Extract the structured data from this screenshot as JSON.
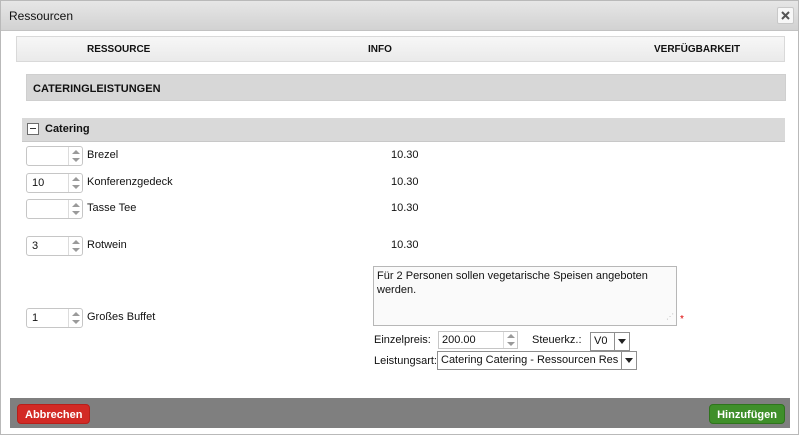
{
  "window": {
    "title": "Ressourcen"
  },
  "columns": {
    "resource": "RESSOURCE",
    "info": "INFO",
    "availability": "VERFÜGBARKEIT"
  },
  "section": {
    "title": "CATERINGLEISTUNGEN"
  },
  "group": {
    "title": "Catering"
  },
  "items": [
    {
      "qty": "",
      "name": "Brezel",
      "time": "10.30"
    },
    {
      "qty": "10",
      "name": "Konferenzgedeck",
      "time": "10.30"
    },
    {
      "qty": "",
      "name": "Tasse Tee",
      "time": "10.30"
    },
    {
      "qty": "3",
      "name": "Rotwein",
      "time": "10.30"
    },
    {
      "qty": "1",
      "name": "Großes Buffet",
      "time": ""
    }
  ],
  "buffet": {
    "note": "Für 2 Personen sollen vegetarische Speisen angeboten werden.",
    "required_mark": "*",
    "unit_price_label": "Einzelpreis:",
    "unit_price": "200.00",
    "tax_label": "Steuerkz.:",
    "tax_value": "V0",
    "service_type_label": "Leistungsart:",
    "service_type_value": "Catering Catering - Ressourcen Res"
  },
  "footer": {
    "cancel_label": "Abbrechen",
    "add_label": "Hinzufügen"
  },
  "colors": {
    "cancel": "#d22a25",
    "add": "#3f8f2a",
    "footer_bar": "#7f7f7f"
  }
}
